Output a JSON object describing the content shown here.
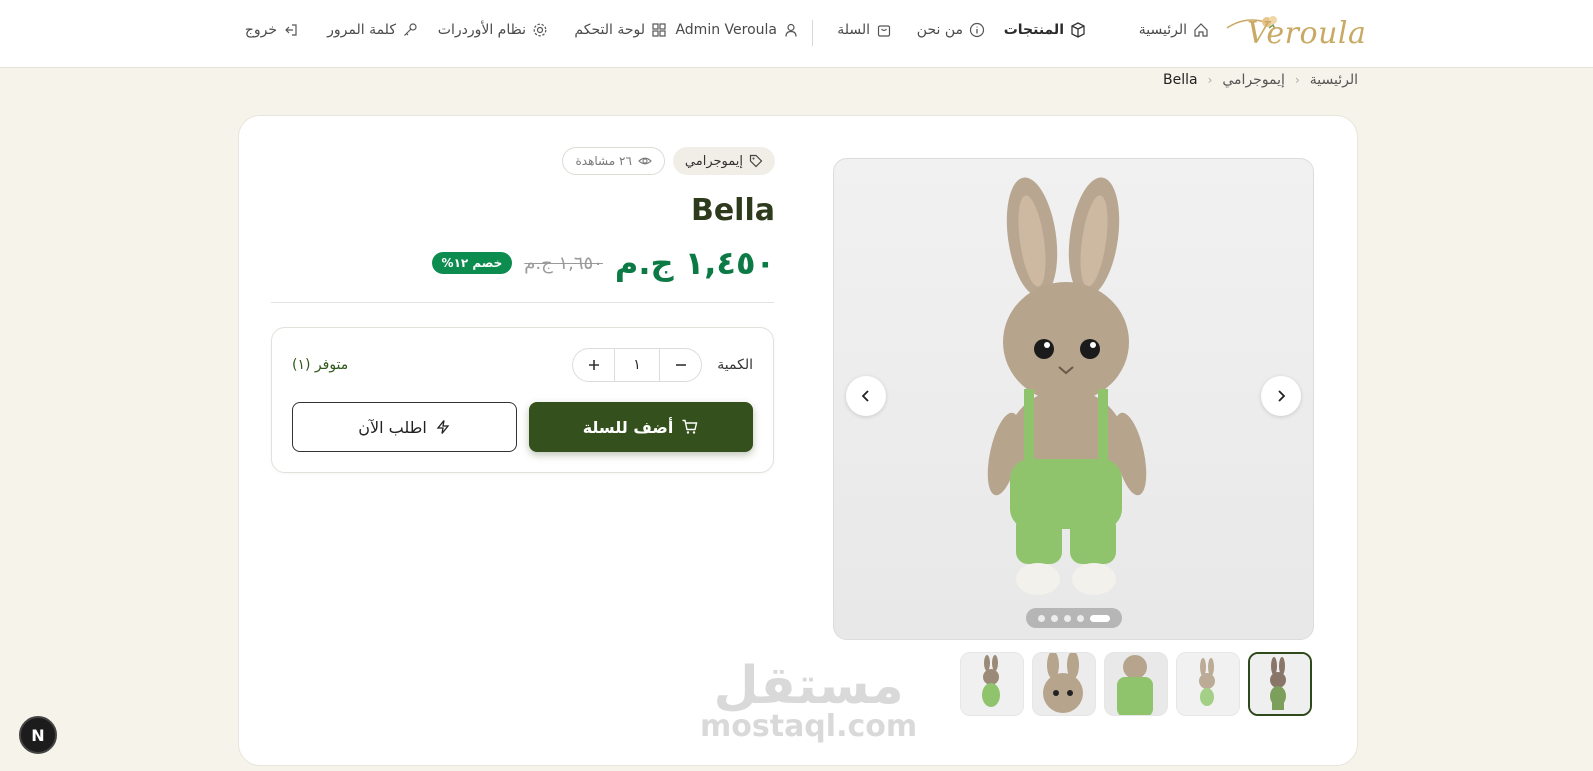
{
  "header": {
    "logo_text": "Veroula",
    "nav": {
      "home": "الرئيسية",
      "products": "المنتجات",
      "about": "من نحن",
      "cart": "السلة",
      "user": "Admin Veroula",
      "dashboard": "لوحة التحكم",
      "orders": "نظام الأوردرات",
      "password": "كلمة المرور",
      "logout": "خروج"
    }
  },
  "breadcrumb": {
    "home": "الرئيسية",
    "category": "إيموجرامي",
    "current": "Bella"
  },
  "product": {
    "category_tag": "إيموجرامي",
    "views": "٢٦ مشاهدة",
    "title": "Bella",
    "price": "١,٤٥٠ ج.م",
    "old_price": "١,٦٥٠ ج.م",
    "discount": "خصم ١٢%",
    "quantity_label": "الكمية",
    "quantity_value": "١",
    "stock": "متوفر (١)",
    "add_to_cart": "أضف للسلة",
    "order_now": "اطلب الآن"
  },
  "gallery": {
    "image_count": 5,
    "active_index": 0
  },
  "watermark": {
    "arabic": "مستقل",
    "latin": "mostaql.com"
  },
  "badge": {
    "letter": "N"
  },
  "colors": {
    "primary": "#34501c",
    "price": "#0c7a45",
    "discount": "#0c8c4e",
    "background": "#f6f3ea",
    "logo": "#c9a964"
  }
}
